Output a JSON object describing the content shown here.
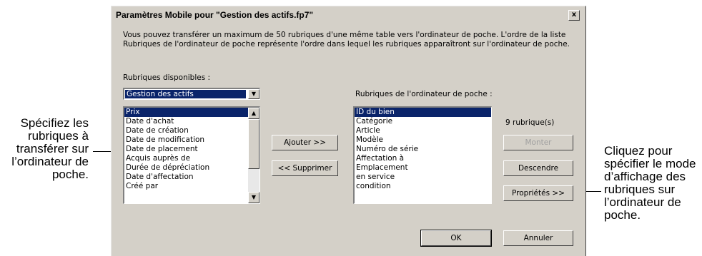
{
  "annotations": {
    "left": [
      "Spécifiez les",
      "rubriques à",
      "transférer sur",
      "l’ordinateur de",
      "poche."
    ],
    "right": [
      "Cliquez pour",
      "spécifier le mode",
      "d’affichage des",
      "rubriques sur",
      "l’ordinateur de",
      "poche."
    ]
  },
  "dialog": {
    "title": "Paramètres Mobile pour \"Gestion des actifs.fp7\"",
    "close_label": "x",
    "description": "Vous pouvez transférer un maximum de 50 rubriques d'une même table vers l'ordinateur de poche. L'ordre de la liste Rubriques de l'ordinateur de poche représente l'ordre dans lequel les rubriques apparaîtront sur l'ordinateur de poche.",
    "available_label": "Rubriques disponibles :",
    "table_select": "Gestion des actifs",
    "available_items": [
      "Prix",
      "Date d'achat",
      "Date de création",
      "Date de modification",
      "Date de placement",
      "Acquis auprès de",
      "Durée de dépréciation",
      "Date d'affectation",
      "Créé par"
    ],
    "available_selected": 0,
    "pocket_label": "Rubriques de l'ordinateur de poche :",
    "pocket_items": [
      "ID du bien",
      "Catégorie",
      "Article",
      "Modèle",
      "Numéro de série",
      "Affectation à",
      "Emplacement",
      "en service",
      "condition"
    ],
    "pocket_selected": 0,
    "count_label": "9 rubrique(s)",
    "buttons": {
      "add": "Ajouter >>",
      "remove": "<< Supprimer",
      "move_up": "Monter",
      "move_down": "Descendre",
      "properties": "Propriétés >>",
      "ok": "OK",
      "cancel": "Annuler"
    }
  }
}
